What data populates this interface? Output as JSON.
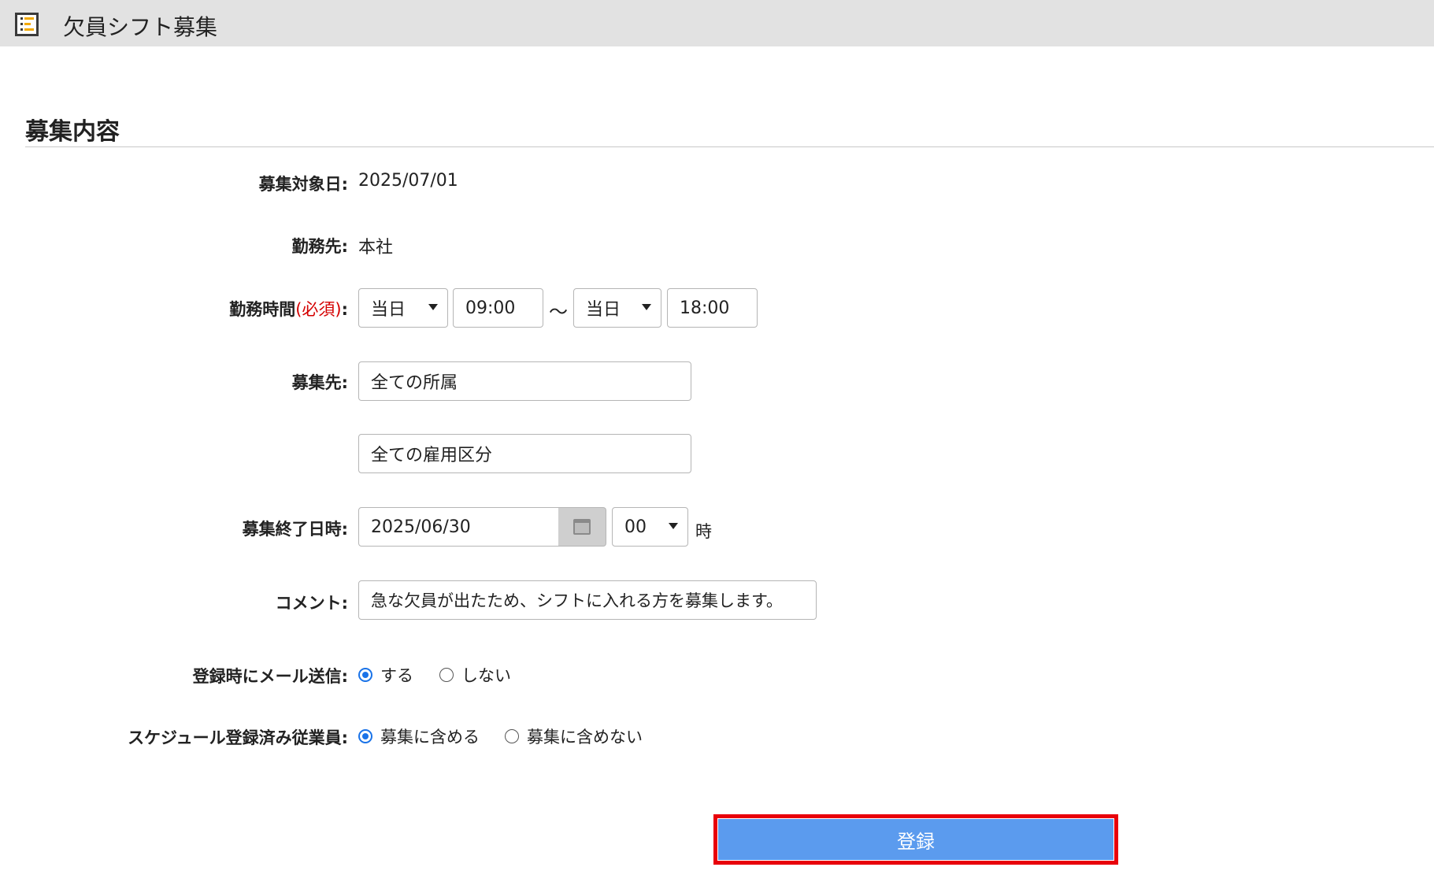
{
  "window": {
    "title": "欠員シフト募集",
    "icon": "schedule-list-icon"
  },
  "section": {
    "heading": "募集内容"
  },
  "form": {
    "target_date": {
      "label": "募集対象日:",
      "value": "2025/07/01"
    },
    "workplace": {
      "label": "勤務先:",
      "value": "本社"
    },
    "work_time": {
      "label": "勤務時間",
      "required": "(必須)",
      "colon": ":",
      "start_day": "当日",
      "start_time": "09:00",
      "separator": "～",
      "end_day": "当日",
      "end_time": "18:00"
    },
    "recruit_to": {
      "label": "募集先:",
      "department": "全ての所属",
      "employment_type": "全ての雇用区分"
    },
    "deadline": {
      "label": "募集終了日時:",
      "date": "2025/06/30",
      "hour": "00",
      "hour_unit": "時"
    },
    "comment": {
      "label": "コメント:",
      "value": "急な欠員が出たため、シフトに入れる方を募集します。"
    },
    "mail_on_register": {
      "label": "登録時にメール送信:",
      "options": [
        "する",
        "しない"
      ],
      "selected": "する"
    },
    "scheduled_employees": {
      "label": "スケジュール登録済み従業員:",
      "options": [
        "募集に含める",
        "募集に含めない"
      ],
      "selected": "募集に含める"
    }
  },
  "actions": {
    "submit_label": "登録"
  },
  "colors": {
    "titlebar_bg": "#e2e2e2",
    "required_text": "#d40000",
    "submit_button": "#5b9bee",
    "highlight_frame": "#e8000b",
    "radio_checked": "#1a73e8"
  }
}
